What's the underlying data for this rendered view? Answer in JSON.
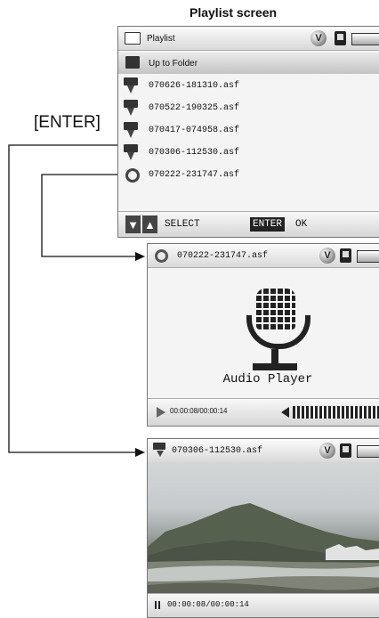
{
  "caption": "Playlist screen",
  "enter_label": "[ENTER]",
  "playlist": {
    "title": "Playlist",
    "up_to_folder": "Up to Folder",
    "files": [
      "070626-181310.asf",
      "070522-190325.asf",
      "070417-074958.asf",
      "070306-112530.asf",
      "070222-231747.asf"
    ],
    "file_icons": [
      "video-camera-icon",
      "video-camera-icon",
      "video-camera-icon",
      "video-camera-icon",
      "audio-magnifier-icon"
    ],
    "footer": {
      "select": "SELECT",
      "enter_key": "ENTER",
      "ok": "OK"
    }
  },
  "audio": {
    "filename": "070222-231747.asf",
    "label": "Audio Player",
    "time": "00:00:08/00:00:14"
  },
  "video": {
    "filename": "070306-112530.asf",
    "time": "00:00:08/00:00:14"
  },
  "status_badge": "V",
  "colors": {
    "accent": "#222222",
    "highlight_row": "#c9c9c9",
    "screen_bg": "#f4f4f4"
  }
}
